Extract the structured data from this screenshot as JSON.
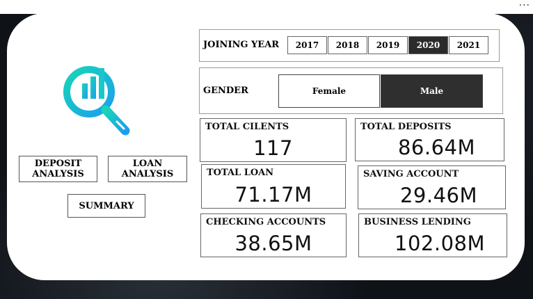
{
  "window": {
    "more_menu": "···"
  },
  "nav": {
    "deposit_analysis": "DEPOSIT ANALYSIS",
    "loan_analysis": "LOAN ANALYSIS",
    "summary": "SUMMARY"
  },
  "filters": {
    "joining_year": {
      "label": "JOINING YEAR",
      "options": [
        "2017",
        "2018",
        "2019",
        "2020",
        "2021"
      ],
      "selected": "2020"
    },
    "gender": {
      "label": "GENDER",
      "options": [
        "Female",
        "Male"
      ],
      "selected": "Male"
    }
  },
  "kpis": {
    "total_clients": {
      "title": "TOTAL CILENTS",
      "value": "117"
    },
    "total_deposits": {
      "title": "TOTAL DEPOSITS",
      "value": "86.64M"
    },
    "total_loan": {
      "title": "TOTAL LOAN",
      "value": "71.17M"
    },
    "saving_account": {
      "title": "SAVING ACCOUNT",
      "value": "29.46M"
    },
    "checking_accounts": {
      "title": "CHECKING ACCOUNTS",
      "value": "38.65M"
    },
    "business_lending": {
      "title": "BUSINESS LENDING",
      "value": "102.08M"
    }
  },
  "colors": {
    "logo_gradient_start": "#19d4b8",
    "logo_gradient_end": "#1a9ff0",
    "selected_fill": "#2b2b2b"
  },
  "icons": {
    "logo": "analytics-magnifier-icon"
  }
}
